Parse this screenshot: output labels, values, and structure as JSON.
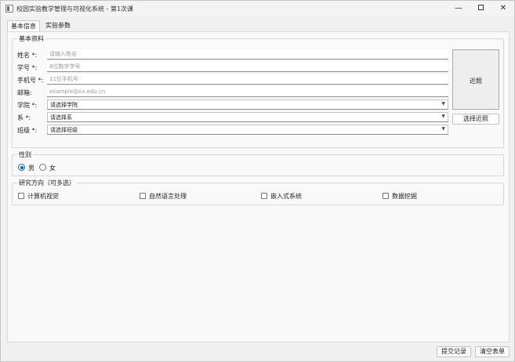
{
  "window": {
    "title": "校园实验教学管理与可视化系统 - 第1次课",
    "minimize_glyph": "—",
    "close_glyph": "✕"
  },
  "tabs": [
    {
      "label": "基本信息",
      "active": true
    },
    {
      "label": "实验参数",
      "active": false
    }
  ],
  "basic_info": {
    "group_title": "基本资料",
    "fields": {
      "name": {
        "label": "姓名 *:",
        "placeholder": "请输入姓名",
        "value": ""
      },
      "student_id": {
        "label": "学号 *:",
        "placeholder": "8位数字学号",
        "value": ""
      },
      "phone": {
        "label": "手机号 *:",
        "placeholder": "11位手机号",
        "value": ""
      },
      "email": {
        "label": "邮箱:",
        "placeholder": "example@xx.edu.cn",
        "value": ""
      },
      "college": {
        "label": "学院 *:",
        "selected": "请选择学院"
      },
      "department": {
        "label": "系 *:",
        "selected": "请选择系"
      },
      "class": {
        "label": "班级 *:",
        "selected": "请选择班级"
      }
    },
    "photo": {
      "placeholder": "近照",
      "button_label": "选择近照"
    }
  },
  "gender": {
    "group_title": "性别",
    "options": [
      {
        "label": "男",
        "checked": true
      },
      {
        "label": "女",
        "checked": false
      }
    ]
  },
  "research": {
    "group_title": "研究方向（可多选）",
    "options": [
      {
        "label": "计算机视觉",
        "checked": false
      },
      {
        "label": "自然语言处理",
        "checked": false
      },
      {
        "label": "嵌入式系统",
        "checked": false
      },
      {
        "label": "数据挖掘",
        "checked": false
      }
    ]
  },
  "footer": {
    "submit_label": "提交记录",
    "clear_label": "清空表单"
  },
  "colors": {
    "accent": "#0067c0",
    "window_bg": "#f0f0f0",
    "panel_bg": "#f9f9f9"
  },
  "icons": [
    "app-icon",
    "minimize-icon",
    "maximize-icon",
    "close-icon",
    "chevron-down-icon"
  ]
}
